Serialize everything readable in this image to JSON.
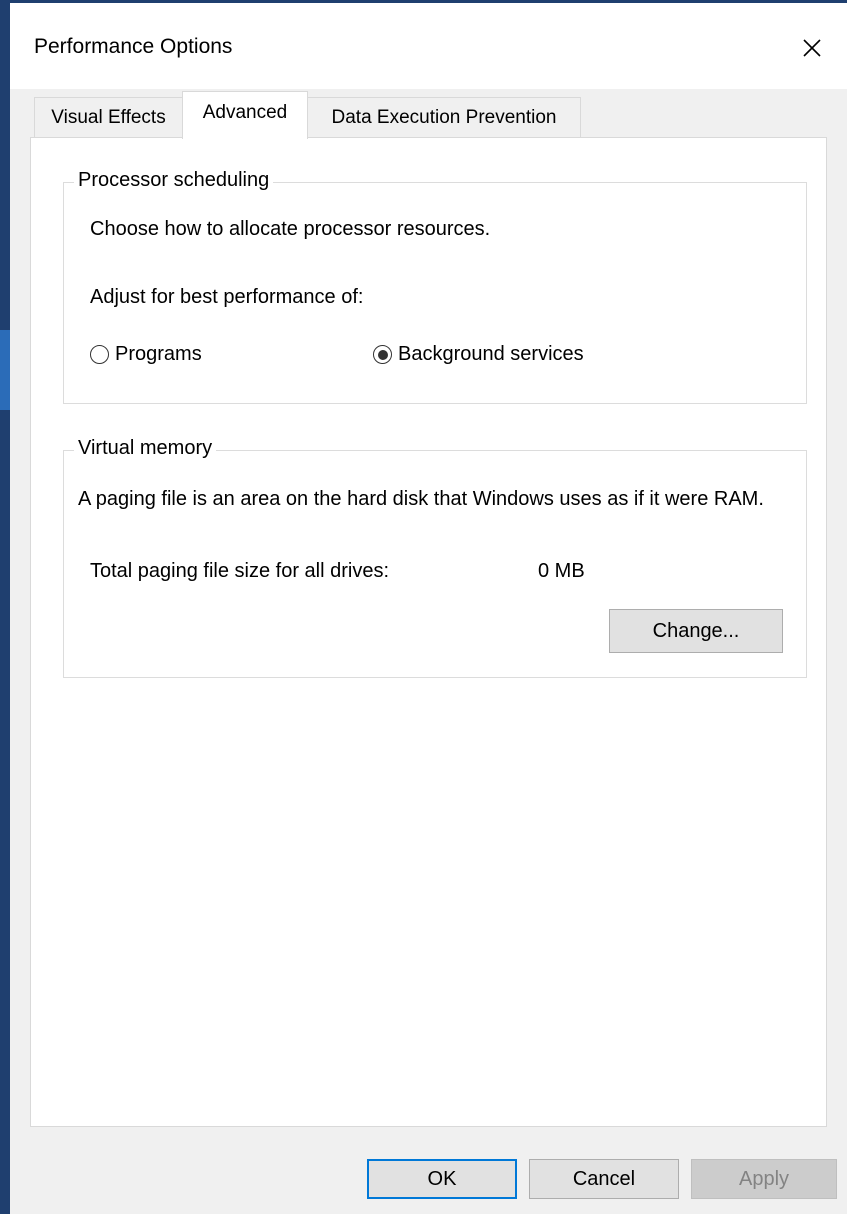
{
  "window": {
    "title": "Performance Options"
  },
  "tabs": [
    {
      "label": "Visual Effects",
      "active": false
    },
    {
      "label": "Advanced",
      "active": true
    },
    {
      "label": "Data Execution Prevention",
      "active": false
    }
  ],
  "processor_scheduling": {
    "legend": "Processor scheduling",
    "description": "Choose how to allocate processor resources.",
    "adjust_label": "Adjust for best performance of:",
    "options": [
      {
        "label": "Programs",
        "selected": false
      },
      {
        "label": "Background services",
        "selected": true
      }
    ]
  },
  "virtual_memory": {
    "legend": "Virtual memory",
    "description": "A paging file is an area on the hard disk that Windows uses as if it were RAM.",
    "total_label": "Total paging file size for all drives:",
    "total_value": "0 MB",
    "change_button": "Change..."
  },
  "footer": {
    "ok": "OK",
    "cancel": "Cancel",
    "apply": "Apply"
  },
  "colors": {
    "accent": "#0078d7",
    "window_border": "#1f3f6f",
    "disabled_text": "#838383"
  },
  "icons": {
    "close": "close-icon"
  }
}
